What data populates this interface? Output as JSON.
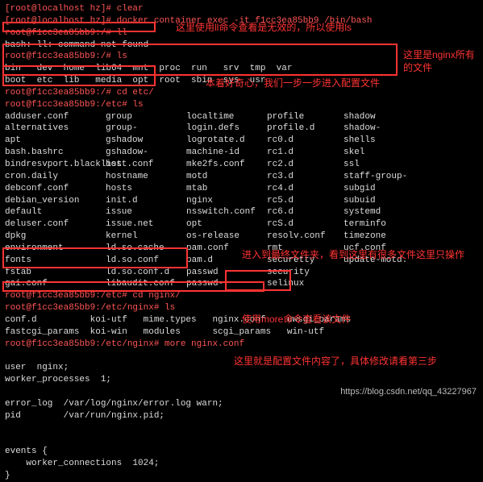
{
  "lines": {
    "l0": "[root@localhost hz]# clear",
    "l1": "[root@localhost hz]# docker container exec -it f1cc3ea85bb9 /bin/bash",
    "l2": "root@f1cc3ea85bb9:/# ll",
    "l3": "bash: ll: command not found",
    "l4": "root@f1cc3ea85bb9:/# ls",
    "l5": "bin   dev  home  lib64  mnt  proc  run   srv  tmp  var",
    "l6": "boot  etc  lib   media  opt  root  sbin  sys  usr",
    "l7": "root@f1cc3ea85bb9:/# cd etc/",
    "l8": "root@f1cc3ea85bb9:/etc# ls"
  },
  "etc_listing": [
    [
      "adduser.conf",
      "group",
      "localtime",
      "profile",
      "shadow"
    ],
    [
      "alternatives",
      "group-",
      "login.defs",
      "profile.d",
      "shadow-"
    ],
    [
      "apt",
      "gshadow",
      "logrotate.d",
      "rc0.d",
      "shells"
    ],
    [
      "bash.bashrc",
      "gshadow-",
      "machine-id",
      "rc1.d",
      "skel"
    ],
    [
      "bindresvport.blacklist",
      "host.conf",
      "mke2fs.conf",
      "rc2.d",
      "ssl"
    ],
    [
      "cron.daily",
      "hostname",
      "motd",
      "rc3.d",
      "staff-group-"
    ],
    [
      "debconf.conf",
      "hosts",
      "mtab",
      "rc4.d",
      "subgid"
    ],
    [
      "debian_version",
      "init.d",
      "nginx",
      "rc5.d",
      "subuid"
    ],
    [
      "default",
      "issue",
      "nsswitch.conf",
      "rc6.d",
      "systemd"
    ],
    [
      "deluser.conf",
      "issue.net",
      "opt",
      "rcS.d",
      "terminfo"
    ],
    [
      "dpkg",
      "kernel",
      "os-release",
      "resolv.conf",
      "timezone"
    ],
    [
      "environment",
      "ld.so.cache",
      "pam.conf",
      "rmt",
      "ucf.conf"
    ],
    [
      "fonts",
      "ld.so.conf",
      "pam.d",
      "securetty",
      "update-motd."
    ],
    [
      "fstab",
      "ld.so.conf.d",
      "passwd",
      "security",
      ""
    ],
    [
      "gai.conf",
      "libaudit.conf",
      "passwd-",
      "selinux",
      ""
    ]
  ],
  "nginx_section": {
    "p1": "root@f1cc3ea85bb9:/etc# cd nginx/",
    "p2": "root@f1cc3ea85bb9:/etc/nginx# ls",
    "row1": [
      "conf.d",
      "koi-utf",
      "mime.types",
      "nginx.conf",
      "uwsgi_params"
    ],
    "row2": [
      "fastcgi_params",
      "koi-win",
      "modules",
      "scgi_params",
      "win-utf"
    ],
    "p3": "root@f1cc3ea85bb9:/etc/nginx# more nginx.conf"
  },
  "nginx_conf": [
    "",
    "user  nginx;",
    "worker_processes  1;",
    "",
    "error_log  /var/log/nginx/error.log warn;",
    "pid        /var/run/nginx.pid;",
    "",
    "",
    "events {",
    "    worker_connections  1024;",
    "}"
  ],
  "annotations": {
    "a1": "这里使用ll命令查看是无效的，所以使用ls",
    "a2": "这里是nginx所有\n的文件",
    "a3": "本着好奇心，我们一步一步进入配置文件",
    "a4": "进入到最终文件夹，看到这里有很多文件这里只操作",
    "a5": "使用more命令查看该文件",
    "a6": "这里就是配置文件内容了，具体修改请看第三步"
  },
  "watermark": "https://blog.csdn.net/qq_43227967"
}
